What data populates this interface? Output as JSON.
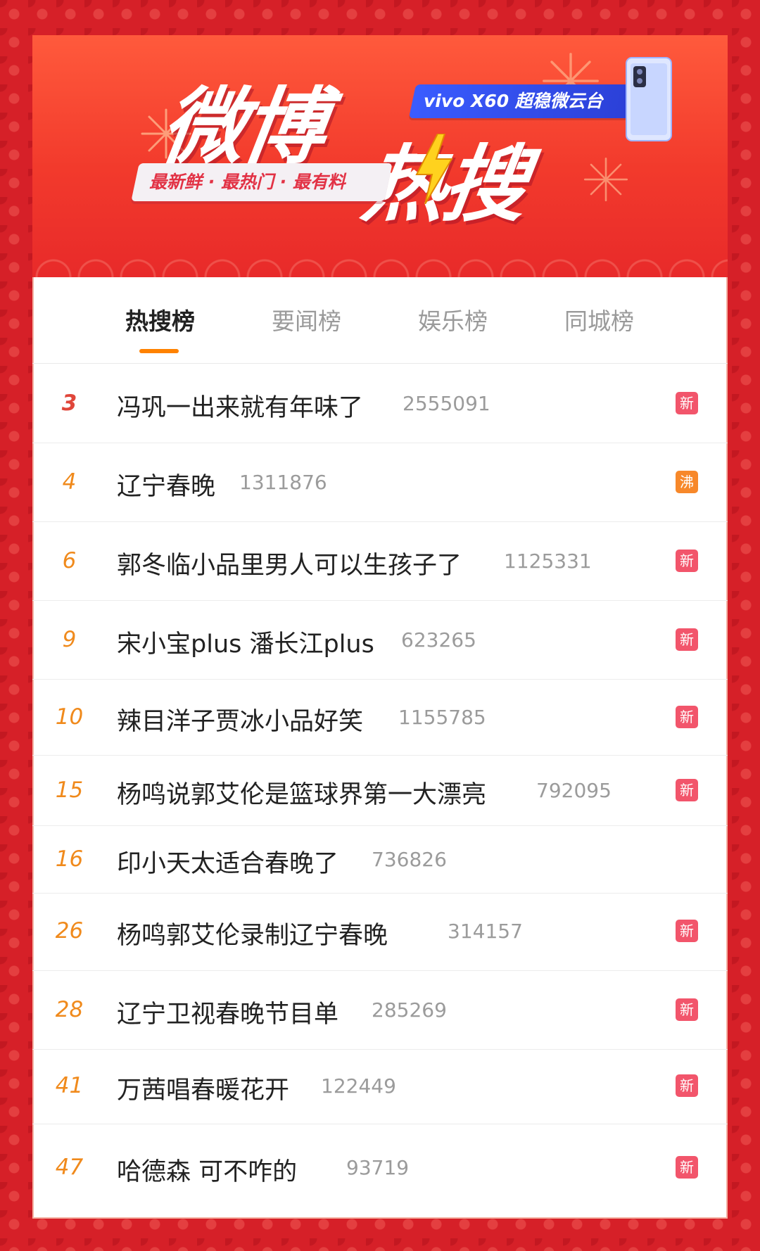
{
  "banner": {
    "title_part1": "微博",
    "title_part2": "热搜",
    "sponsor": "vivo X60 超稳微云台",
    "slogan": "最新鲜 · 最热门 · 最有料",
    "colors": {
      "banner_top": "#ff5a3c",
      "banner_bottom": "#e82a2a",
      "sponsor_pill": "#3a5cff"
    }
  },
  "tabs": [
    {
      "label": "热搜榜",
      "active": true
    },
    {
      "label": "要闻榜",
      "active": false
    },
    {
      "label": "娱乐榜",
      "active": false
    },
    {
      "label": "同城榜",
      "active": false
    }
  ],
  "list": [
    {
      "rank": "3",
      "title": "冯巩一出来就有年味了",
      "count": "2555091",
      "badge": "新",
      "badge_color": "#f2556b"
    },
    {
      "rank": "4",
      "title": "辽宁春晚",
      "count": "1311876",
      "badge": "沸",
      "badge_color": "#f7882a"
    },
    {
      "rank": "6",
      "title": "郭冬临小品里男人可以生孩子了",
      "count": "1125331",
      "badge": "新",
      "badge_color": "#f2556b"
    },
    {
      "rank": "9",
      "title": "宋小宝plus 潘长江plus",
      "count": "623265",
      "badge": "新",
      "badge_color": "#f2556b"
    },
    {
      "rank": "10",
      "title": "辣目洋子贾冰小品好笑",
      "count": "1155785",
      "badge": "新",
      "badge_color": "#f2556b"
    },
    {
      "rank": "15",
      "title": "杨鸣说郭艾伦是篮球界第一大漂亮",
      "count": "792095",
      "badge": "新",
      "badge_color": "#f2556b"
    },
    {
      "rank": "16",
      "title": "印小天太适合春晚了",
      "count": "736826",
      "badge": "",
      "badge_color": ""
    },
    {
      "rank": "26",
      "title": "杨鸣郭艾伦录制辽宁春晚",
      "count": "314157",
      "badge": "新",
      "badge_color": "#f2556b"
    },
    {
      "rank": "28",
      "title": "辽宁卫视春晚节目单",
      "count": "285269",
      "badge": "新",
      "badge_color": "#f2556b"
    },
    {
      "rank": "41",
      "title": "万茜唱春暖花开",
      "count": "122449",
      "badge": "新",
      "badge_color": "#f2556b"
    },
    {
      "rank": "47",
      "title": "哈德森 可不咋的",
      "count": "93719",
      "badge": "新",
      "badge_color": "#f2556b"
    }
  ],
  "theme": {
    "active_tab_underline": "#ff8200",
    "rank_color": "#f08a1c",
    "top_rank_color": "#e0463a"
  }
}
